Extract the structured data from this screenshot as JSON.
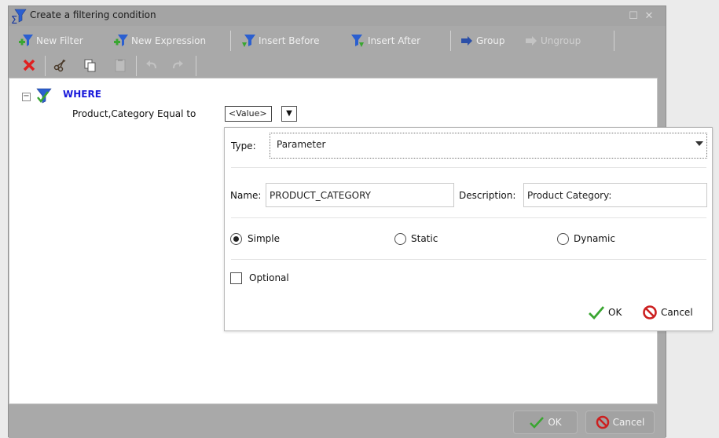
{
  "dialog": {
    "title": "Create a filtering condition",
    "toolbar": {
      "new_filter": "New Filter",
      "new_expression": "New Expression",
      "insert_before": "Insert Before",
      "insert_after": "Insert After",
      "group": "Group",
      "ungroup": "Ungroup"
    },
    "tree": {
      "root_label": "WHERE",
      "condition_text": "Product,Category  Equal to",
      "value_text": "<Value>"
    },
    "popup": {
      "type_label": "Type:",
      "type_value": "Parameter",
      "name_label": "Name:",
      "name_value": "PRODUCT_CATEGORY",
      "description_label": "Description:",
      "description_value": "Product Category:",
      "radio_simple": "Simple",
      "radio_static": "Static",
      "radio_dynamic": "Dynamic",
      "radio_selected": "Simple",
      "optional_label": "Optional",
      "optional_checked": false,
      "ok_label": "OK",
      "cancel_label": "Cancel"
    },
    "footer": {
      "ok_label": "OK",
      "cancel_label": "Cancel"
    }
  },
  "colors": {
    "chrome_gray": "#a9a9a9",
    "where_blue": "#1a1adb",
    "ok_green": "#3aa631",
    "cancel_red": "#cc2020",
    "delete_red": "#e02020"
  },
  "icons": [
    "filter-funnel-icon",
    "new-filter-icon",
    "new-expression-icon",
    "insert-before-icon",
    "insert-after-icon",
    "group-icon",
    "ungroup-icon",
    "delete-icon",
    "cut-icon",
    "copy-icon",
    "paste-icon",
    "undo-icon",
    "redo-icon",
    "check-icon",
    "no-icon"
  ]
}
